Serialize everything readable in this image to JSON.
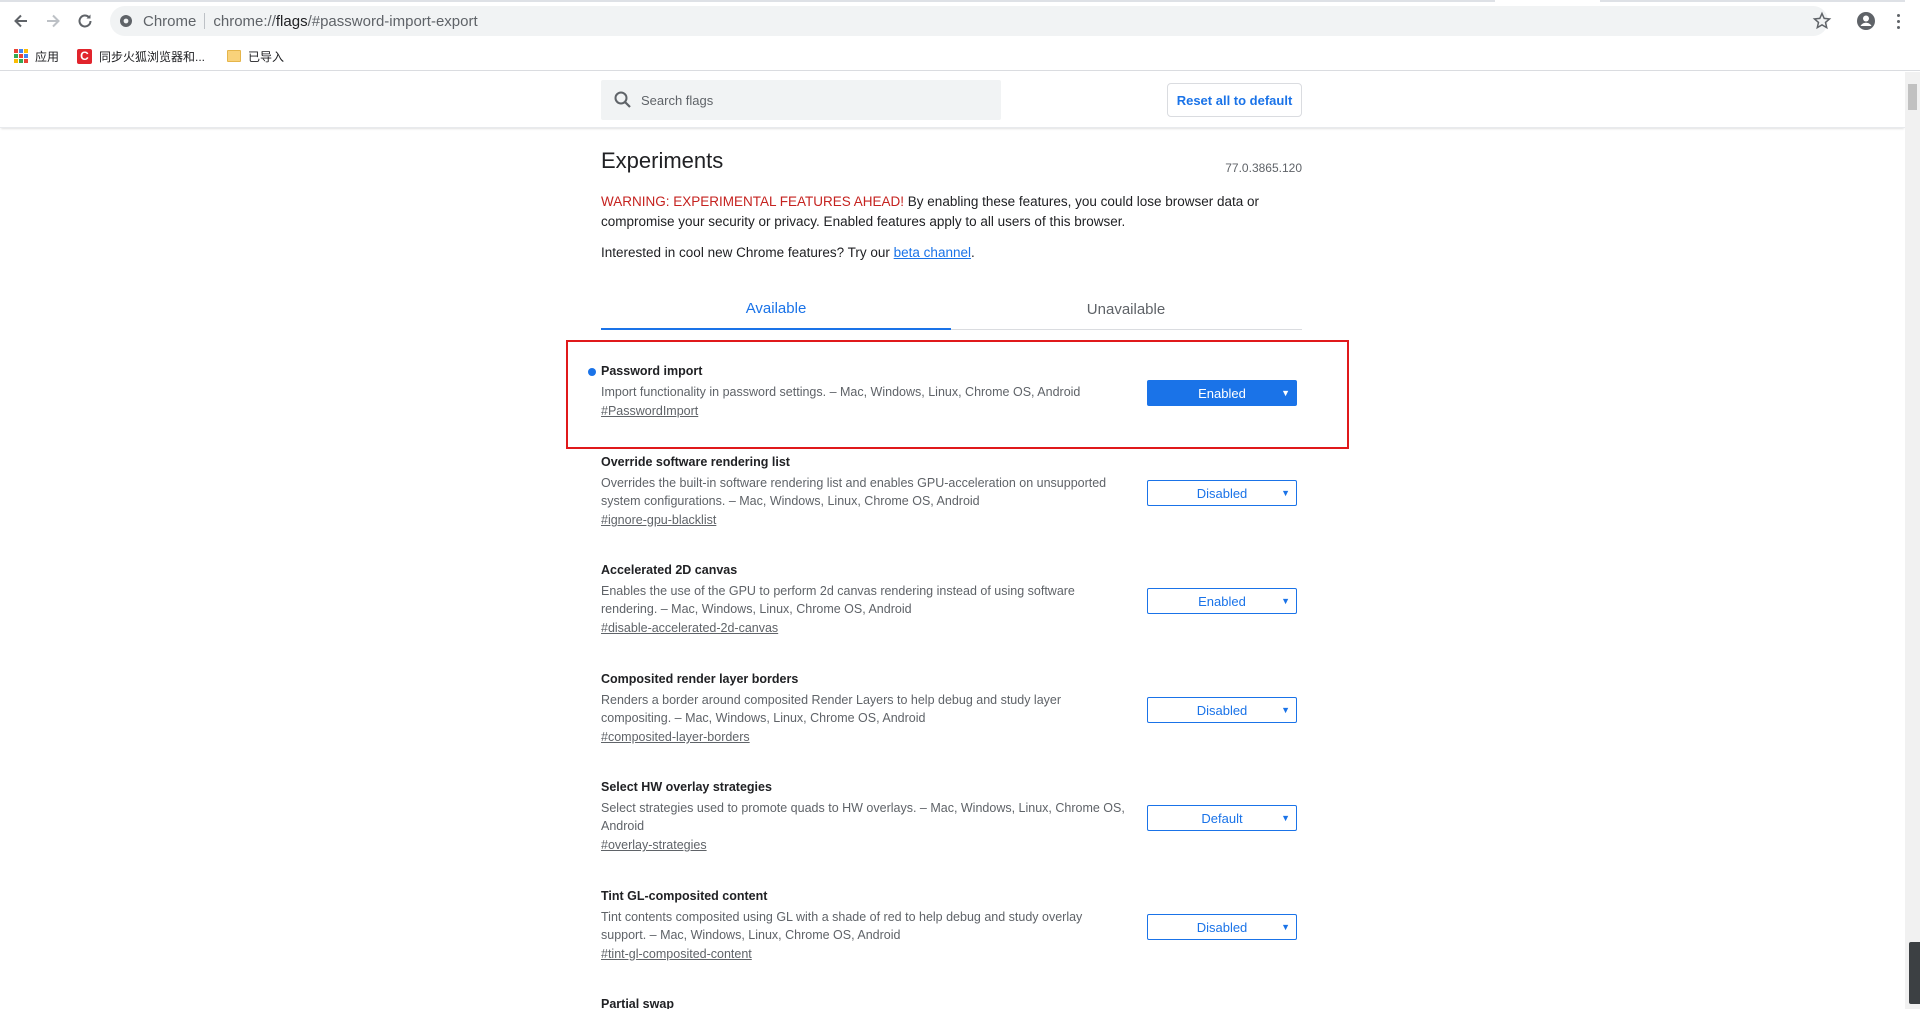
{
  "browser": {
    "site_name": "Chrome",
    "url_host": "chrome://",
    "url_bold": "flags",
    "url_rest": "/#password-import-export"
  },
  "bookmarks": {
    "items": [
      {
        "label": "应用",
        "icon": "apps-grid-icon"
      },
      {
        "label": "同步火狐浏览器和...",
        "icon": "red-bookmark-icon"
      },
      {
        "label": "已导入",
        "icon": "folder-icon"
      }
    ]
  },
  "header": {
    "search_placeholder": "Search flags",
    "reset_label": "Reset all to default"
  },
  "page": {
    "title": "Experiments",
    "version": "77.0.3865.120",
    "warning_label": "WARNING: EXPERIMENTAL FEATURES AHEAD!",
    "warning_text": " By enabling these features, you could lose browser data or compromise your security or privacy. Enabled features apply to all users of this browser.",
    "beta_prefix": "Interested in cool new Chrome features? Try our ",
    "beta_link": "beta channel",
    "beta_suffix": "."
  },
  "tabs": [
    {
      "label": "Available",
      "active": true
    },
    {
      "label": "Unavailable",
      "active": false
    }
  ],
  "flags": [
    {
      "title": "Password import",
      "description": "Import functionality in password settings. – Mac, Windows, Linux, Chrome OS, Android",
      "link": "#PasswordImport",
      "value": "Enabled",
      "modified": true,
      "highlighted": true
    },
    {
      "title": "Override software rendering list",
      "description": "Overrides the built-in software rendering list and enables GPU-acceleration on unsupported system configurations. – Mac, Windows, Linux, Chrome OS, Android",
      "link": "#ignore-gpu-blacklist",
      "value": "Disabled"
    },
    {
      "title": "Accelerated 2D canvas",
      "description": "Enables the use of the GPU to perform 2d canvas rendering instead of using software rendering. – Mac, Windows, Linux, Chrome OS, Android",
      "link": "#disable-accelerated-2d-canvas",
      "value": "Enabled"
    },
    {
      "title": "Composited render layer borders",
      "description": "Renders a border around composited Render Layers to help debug and study layer compositing. – Mac, Windows, Linux, Chrome OS, Android",
      "link": "#composited-layer-borders",
      "value": "Disabled"
    },
    {
      "title": "Select HW overlay strategies",
      "description": "Select strategies used to promote quads to HW overlays. – Mac, Windows, Linux, Chrome OS, Android",
      "link": "#overlay-strategies",
      "value": "Default"
    },
    {
      "title": "Tint GL-composited content",
      "description": "Tint contents composited using GL with a shade of red to help debug and study overlay support. – Mac, Windows, Linux, Chrome OS, Android",
      "link": "#tint-gl-composited-content",
      "value": "Disabled"
    },
    {
      "title": "Partial swap",
      "description": "",
      "link": "",
      "value": ""
    }
  ],
  "colors": {
    "accent": "#1a73e8",
    "warning": "#c5221f",
    "highlight_box": "#e0191b"
  }
}
